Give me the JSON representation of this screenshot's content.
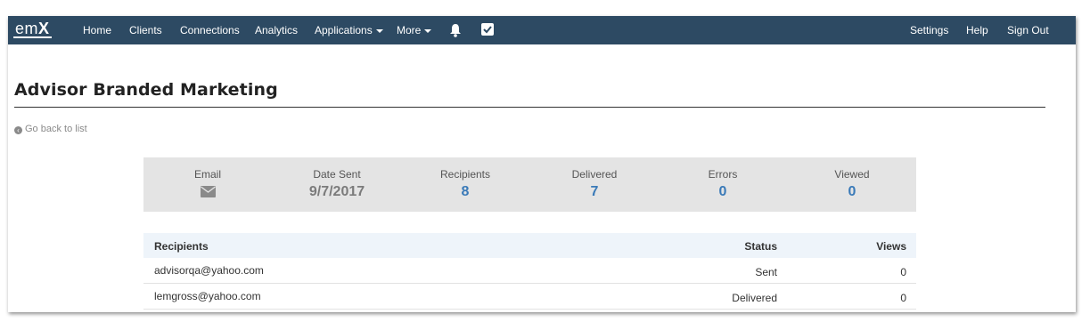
{
  "nav": {
    "brand_prefix": "em",
    "brand_suffix": "X",
    "items": [
      "Home",
      "Clients",
      "Connections",
      "Analytics",
      "Applications",
      "More"
    ],
    "right_items": [
      "Settings",
      "Help",
      "Sign Out"
    ],
    "icons": [
      "bell-icon",
      "checkbox-icon"
    ],
    "color": "#2d4a63"
  },
  "page": {
    "title": "Advisor Branded Marketing",
    "back_link": "Go back to list"
  },
  "stats": {
    "email_label": "Email",
    "date_label": "Date Sent",
    "date_value": "9/7/2017",
    "recipients_label": "Recipients",
    "recipients_value": "8",
    "delivered_label": "Delivered",
    "delivered_value": "7",
    "errors_label": "Errors",
    "errors_value": "0",
    "viewed_label": "Viewed",
    "viewed_value": "0"
  },
  "table": {
    "headers": [
      "Recipients",
      "Status",
      "Views"
    ],
    "rows": [
      {
        "email": "advisorqa@yahoo.com",
        "status": "Sent",
        "views": "0"
      },
      {
        "email": "lemgross@yahoo.com",
        "status": "Delivered",
        "views": "0"
      }
    ]
  }
}
